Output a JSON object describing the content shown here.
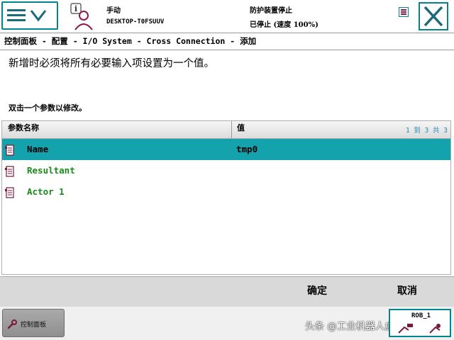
{
  "status": {
    "mode": "手动",
    "hostname": "DESKTOP-T0FSUUV",
    "guard_state": "防护装置停止",
    "run_state": "已停止 (速度 100%)"
  },
  "breadcrumb": "控制面板 - 配置 - I/O System - Cross Connection - 添加",
  "instruction": "新增时必须将所有必要输入项设置为一个值。",
  "hint": "双击一个参数以修改。",
  "table": {
    "headers": {
      "name": "参数名称",
      "value": "值"
    },
    "pager": "1 到 3 共 3",
    "rows": [
      {
        "name": "Name",
        "value": "tmp0",
        "selected": true
      },
      {
        "name": "Resultant",
        "value": "",
        "selected": false
      },
      {
        "name": "Actor 1",
        "value": "",
        "selected": false
      }
    ]
  },
  "commands": {
    "ok": "确定",
    "cancel": "取消"
  },
  "taskbar": {
    "control_panel": "控制面板",
    "rob_label": "ROB_1",
    "watermark": "头条 @工业机器人虚拟调试"
  },
  "icons": {
    "menu": "hamburger-chevron-icon",
    "quickset": "info-operator-icon",
    "close": "close-icon",
    "param": "parameter-doc-icon",
    "wrench": "wrench-icon",
    "robot": "robot-jog-icon"
  },
  "colors": {
    "accent": "#00868b",
    "selected_row": "#14a2ad",
    "param_text": "#1a8a1a",
    "pager_text": "#2a8ab0"
  }
}
